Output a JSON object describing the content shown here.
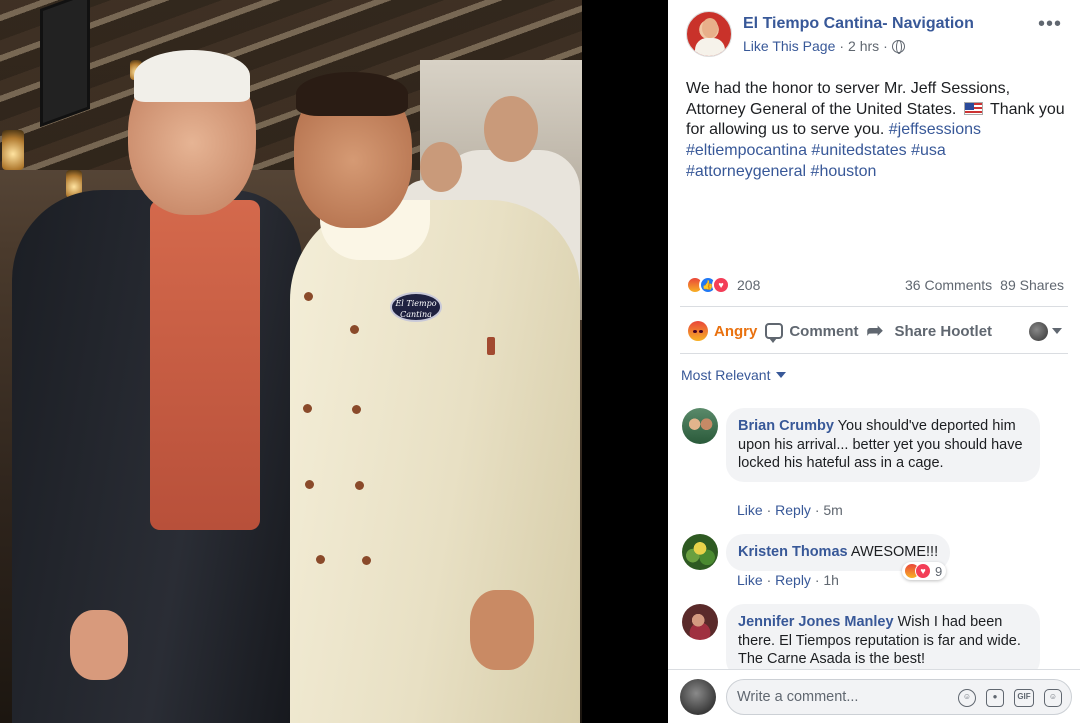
{
  "photo": {
    "chef_patch_text": "El Tiempo Cantina"
  },
  "post": {
    "page_name": "El Tiempo Cantina- Navigation",
    "like_link": "Like This Page",
    "time": "2 hrs",
    "text_before_flag": "We had the honor to server Mr. Jeff Sessions, Attorney General of the United States.",
    "text_after_flag": "Thank you for allowing us to serve you.",
    "hashtags": [
      "#jeffsessions",
      "#eltiempocantina",
      "#unitedstates",
      "#usa",
      "#attorneygeneral",
      "#houston"
    ],
    "more_icon": "more-dots-icon"
  },
  "reactions": {
    "types": [
      "angry",
      "like",
      "love"
    ],
    "count": "208",
    "comments": "36 Comments",
    "shares": "89 Shares"
  },
  "actions": {
    "angry_label": "Angry",
    "comment_label": "Comment",
    "share_label": "Share Hootlet"
  },
  "comments_filter": "Most Relevant",
  "comments": [
    {
      "author": "Brian Crumby",
      "text": "You should've deported him upon his arrival... better yet you should have locked his hateful ass in a cage.",
      "like": "Like",
      "reply": "Reply",
      "time": "5m"
    },
    {
      "author": "Kristen Thomas",
      "text": "AWESOME!!!",
      "like": "Like",
      "reply": "Reply",
      "time": "1h",
      "reaction_count": "9"
    },
    {
      "author": "Jennifer Jones Manley",
      "text": "Wish I had been there. El Tiempos reputation is far and wide. The Carne Asada is the best!"
    }
  ],
  "composer": {
    "placeholder": "Write a comment...",
    "icons": [
      "emoji-icon",
      "camera-icon",
      "gif-icon",
      "sticker-icon"
    ]
  },
  "colors": {
    "link": "#385898",
    "angry": "#e9710f",
    "secondary_text": "#606770",
    "bubble": "#f2f3f5"
  }
}
